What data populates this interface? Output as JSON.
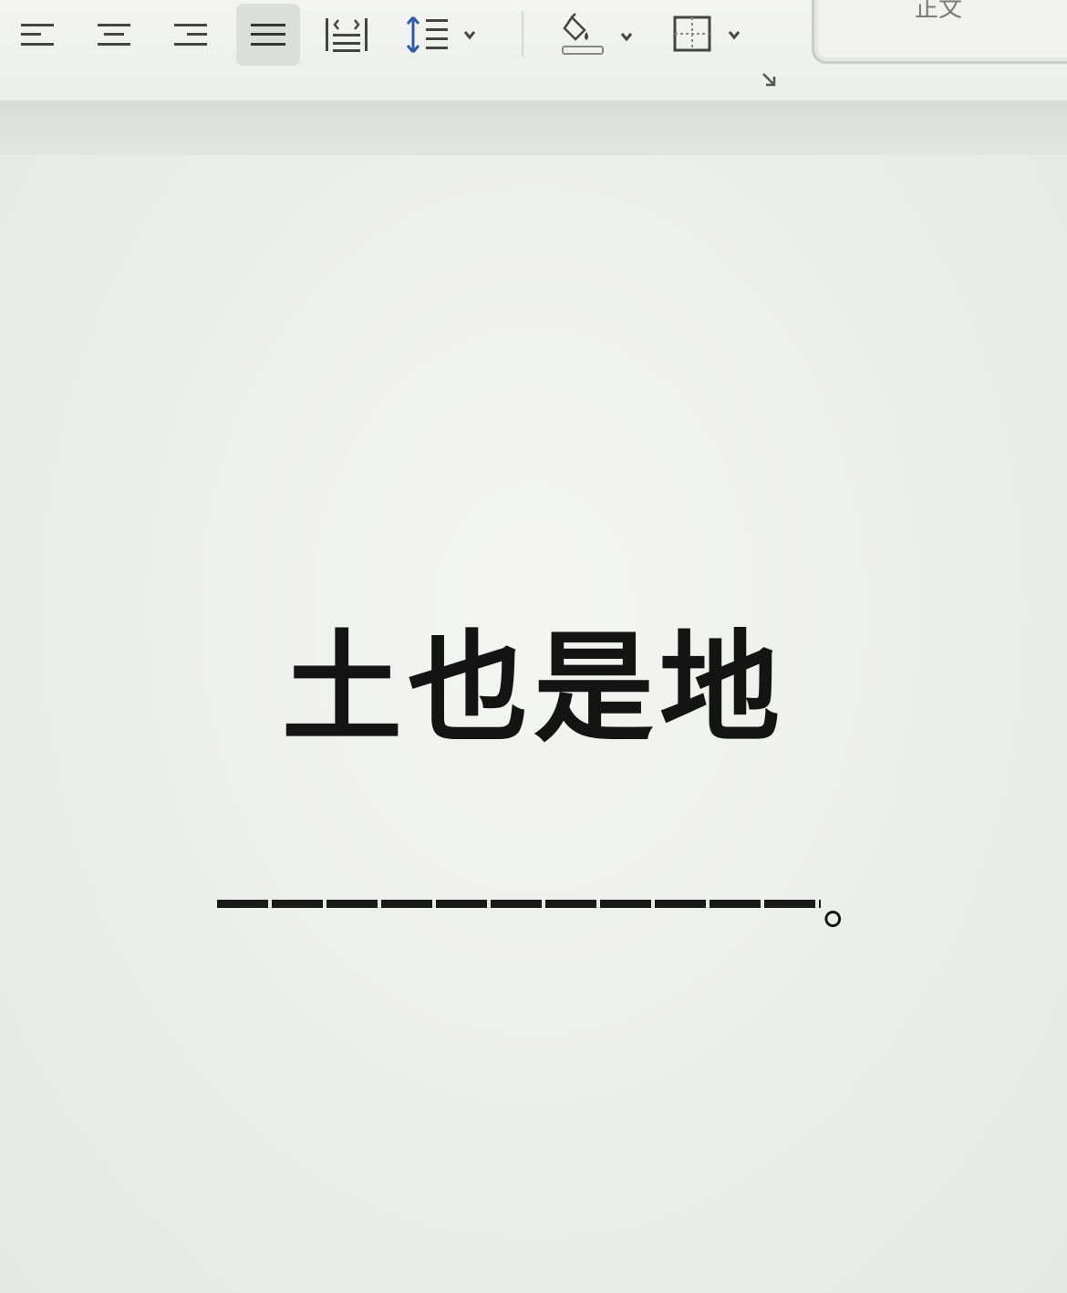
{
  "toolbar": {
    "tools": [
      {
        "name": "align-left-icon"
      },
      {
        "name": "align-center-icon"
      },
      {
        "name": "align-right-icon"
      },
      {
        "name": "justify-icon",
        "active": true
      },
      {
        "name": "distributed-align-icon"
      },
      {
        "name": "line-spacing-icon"
      },
      {
        "name": "shading-icon"
      },
      {
        "name": "borders-icon"
      }
    ],
    "accent_color": "#2f5aa8"
  },
  "style_gallery": {
    "label": "正文"
  },
  "document": {
    "heading": "土也是地",
    "answer_suffix": "。"
  }
}
